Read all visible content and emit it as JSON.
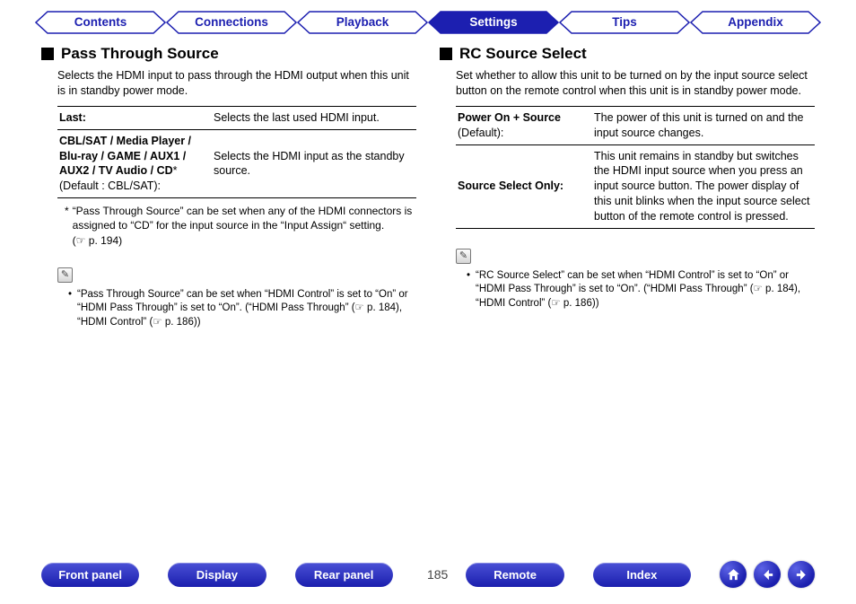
{
  "tabs": [
    "Contents",
    "Connections",
    "Playback",
    "Settings",
    "Tips",
    "Appendix"
  ],
  "active_tab_index": 3,
  "left": {
    "title": "Pass Through Source",
    "intro": "Selects the HDMI input to pass through the HDMI output when this unit is in standby power mode.",
    "rows": [
      {
        "key_bold": "Last:",
        "key_note": "",
        "val": "Selects the last used HDMI input."
      },
      {
        "key_bold": "CBL/SAT / Media Player / Blu-ray / GAME / AUX1 / AUX2 / TV Audio / CD",
        "key_star": "*",
        "key_note": "(Default : CBL/SAT):",
        "val": "Selects the HDMI input as the standby source."
      }
    ],
    "footnote_ast": "*",
    "footnote": "“Pass Through Source” can be set when any of the HDMI connectors is assigned to “CD” for the input source in the “Input Assign“ setting.  (",
    "footnote_link": "☞ p. 194",
    "footnote_tail": ")",
    "bullet": "“Pass Through Source” can be set when “HDMI Control” is set to “On” or “HDMI Pass Through” is set to “On”. (“HDMI Pass Through” (",
    "bullet_link1": "☞ p. 184",
    "bullet_mid": "), “HDMI Control” (",
    "bullet_link2": "☞ p. 186",
    "bullet_tail": "))"
  },
  "right": {
    "title": "RC Source Select",
    "intro": "Set whether to allow this unit to be turned on by the input source select button on the remote control when this unit is in standby power mode.",
    "rows": [
      {
        "key_bold": "Power On + Source",
        "key_note": "(Default):",
        "val": "The power of this unit is turned on and the input source changes."
      },
      {
        "key_bold": "Source Select Only:",
        "key_note": "",
        "val": "This unit remains in standby but switches the HDMI input source when you press an input source button. The power display of this unit blinks when the input source select button of the remote control is pressed."
      }
    ],
    "bullet": "“RC Source Select” can be set when “HDMI Control” is set to “On” or “HDMI Pass Through” is set to “On”. (“HDMI Pass Through” (",
    "bullet_link1": "☞ p. 184",
    "bullet_mid": "), “HDMI Control” (",
    "bullet_link2": "☞ p. 186",
    "bullet_tail": "))"
  },
  "pencil_glyph": "✎",
  "bottom": {
    "pills": [
      "Front panel",
      "Display",
      "Rear panel"
    ],
    "page": "185",
    "pills2": [
      "Remote",
      "Index"
    ]
  }
}
